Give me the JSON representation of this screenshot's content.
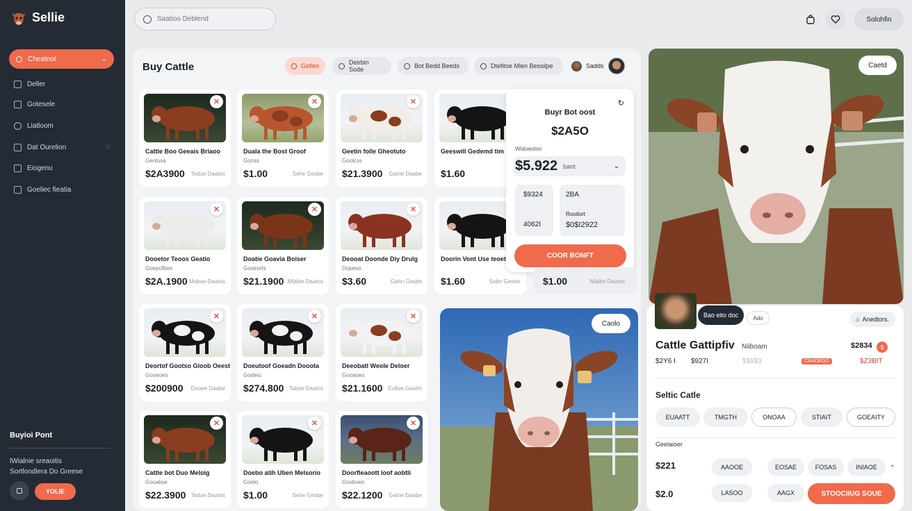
{
  "app": {
    "name": "Sellie",
    "logo": "cow-logo-icon"
  },
  "sidebar": {
    "primary": {
      "label": "Cheatnot",
      "icon": "circle-icon"
    },
    "items": [
      {
        "label": "Deller",
        "icon": "tag-icon"
      },
      {
        "label": "Gotesele",
        "icon": "document-icon"
      },
      {
        "label": "Liatloom",
        "icon": "user-icon"
      },
      {
        "label": "Dat Ourelion",
        "icon": "chat-icon",
        "tail": "shield-icon"
      },
      {
        "label": "Eiogenu",
        "icon": "camera-icon"
      },
      {
        "label": "Goeliec fieatia",
        "icon": "note-icon"
      }
    ],
    "section_title": "Buyioi Pont",
    "text1": "lWialnie sreaoitis",
    "text2": "Sortlondlera Do Greese",
    "button": "YOLIE"
  },
  "topbar": {
    "search_placeholder": "Saatioo Deblend",
    "icons": [
      "bag-icon",
      "heart-icon"
    ],
    "button": "Solohfin"
  },
  "main": {
    "title": "Buy Cattle",
    "chips": [
      "Gelleo",
      "Deirbin Sode",
      "Bot Bedd Beeds",
      "Dtefitoe Mlen Bessilpe"
    ],
    "user": "Sadds"
  },
  "cards": [
    {
      "title": "Cattle Boo Geeais Briaoo",
      "sub": "Geolusa",
      "price": "$2A3900",
      "meta": "Tedue Daatos"
    },
    {
      "title": "Duala the Bost Groof",
      "sub": "Gonss",
      "price": "$1.00",
      "meta": "Sehe Gesbe"
    },
    {
      "title": "Geetin folle Gheotuto",
      "sub": "Goolcss",
      "price": "$21.3900",
      "meta": "Gatrie Daabe"
    },
    {
      "title": "Geeswill Gedemd tim",
      "sub": "",
      "price": "$1.60",
      "meta": ""
    },
    {
      "title": "Dooetor Teoos Geatio",
      "sub": "Goepofbes",
      "price": "$2A.1900",
      "meta": "Maboe Daatos"
    },
    {
      "title": "Doatie Goavia Boiser",
      "sub": "Gooeorls",
      "price": "$21.1900",
      "meta": "Mfaibe Daatos"
    },
    {
      "title": "Deooat Doonde Diy Drulg",
      "sub": "Dopeso",
      "price": "$3.60",
      "meta": "Gahn Gesbe"
    },
    {
      "title": "Doorin Vont Use teoetor",
      "sub": "",
      "price": "$1.60",
      "meta": "Sobn Geeetr"
    },
    {
      "title": "Deortof Gootso Gloob Oeest",
      "sub": "Gooeoes",
      "price": "$200900",
      "meta": "Duoee Daabe"
    },
    {
      "title": "Doeutoof Goeadn Dooota",
      "sub": "Godeiu",
      "price": "$274.800",
      "meta": "Taboe Daatos"
    },
    {
      "title": "Deeobatl Weole Deloer",
      "sub": "Gooaoes",
      "price": "$21.1600",
      "meta": "Eulloe Gaatm"
    },
    {
      "title": "Cattle bot Duo Meloig",
      "sub": "Gooalow",
      "price": "$22.3900",
      "meta": "Tedue Daatos"
    },
    {
      "title": "Doebo atih Uben Melsorio",
      "sub": "Goelo",
      "price": "$1.00",
      "meta": "Sehe Gesbe"
    },
    {
      "title": "Doorfleaoott loof aobtli",
      "sub": "Gosboeo",
      "price": "$22.1200",
      "meta": "Gatrie Daabe"
    }
  ],
  "popup": {
    "title": "Buyr Bot oost",
    "amount": "$2A5O",
    "label": "Widoeotoo",
    "price": "$5.922",
    "unit": "bant",
    "box1_top": "$9324",
    "box1_bottom": "4062I",
    "box2_top": "2BA",
    "box2_mid": "Rooitort",
    "box2_bottom": "$0$I2922",
    "button": "COOR BONFT"
  },
  "ghost": {
    "price": "$1.00",
    "meta": "Nfaibe Daatos"
  },
  "photo_mid": {
    "pill": "Caolo"
  },
  "photo_right": {
    "pill": "Caetd"
  },
  "detail": {
    "tag1": "Bao eito doc",
    "tag2": "Ado",
    "share": "Anedtors.",
    "title": "Cattle Gattipfiv",
    "sub": "Niiboam",
    "price": "$2834",
    "price_badge": "$",
    "row2": [
      "$2Y6 I",
      "$927I",
      "$$8$3",
      "CRAOEGO",
      "$Z3BIT"
    ],
    "section": "Seltic Catle",
    "options": [
      "EUAATT",
      "TMGTH",
      "ONOAA",
      "STIAIT",
      "GOEAITY"
    ],
    "label": "Geelaioer",
    "p1": "$221",
    "p1_opts": [
      "AAOOE",
      "EOSAE",
      "FOSAS",
      "INIAOE"
    ],
    "p2": "$2.0",
    "p2_opts": [
      "LASOO",
      "AAGX"
    ],
    "cta": "STOOCIIUG SOUE"
  }
}
